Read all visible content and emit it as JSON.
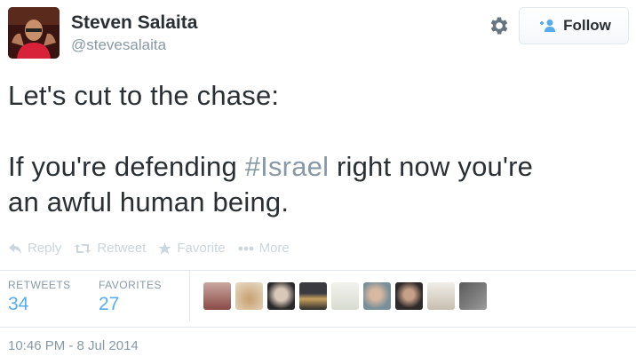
{
  "user": {
    "name": "Steven Salaita",
    "handle": "@stevesalaita",
    "follow_label": "Follow"
  },
  "tweet": {
    "line1": "Let's cut to the chase:",
    "line2_before": "If you're defending ",
    "hashtag": "#Israel",
    "line2_after": " right now you're",
    "line3": "an awful human being."
  },
  "actions": {
    "reply": "Reply",
    "retweet": "Retweet",
    "favorite": "Favorite",
    "more": "More"
  },
  "stats": {
    "retweets_label": "RETWEETS",
    "retweets_count": "34",
    "favorites_label": "FAVORITES",
    "favorites_count": "27"
  },
  "timestamp": "10:46 PM - 8 Jul 2014",
  "colors": {
    "link": "#55acee",
    "muted": "#8899a6",
    "text": "#292f33"
  }
}
